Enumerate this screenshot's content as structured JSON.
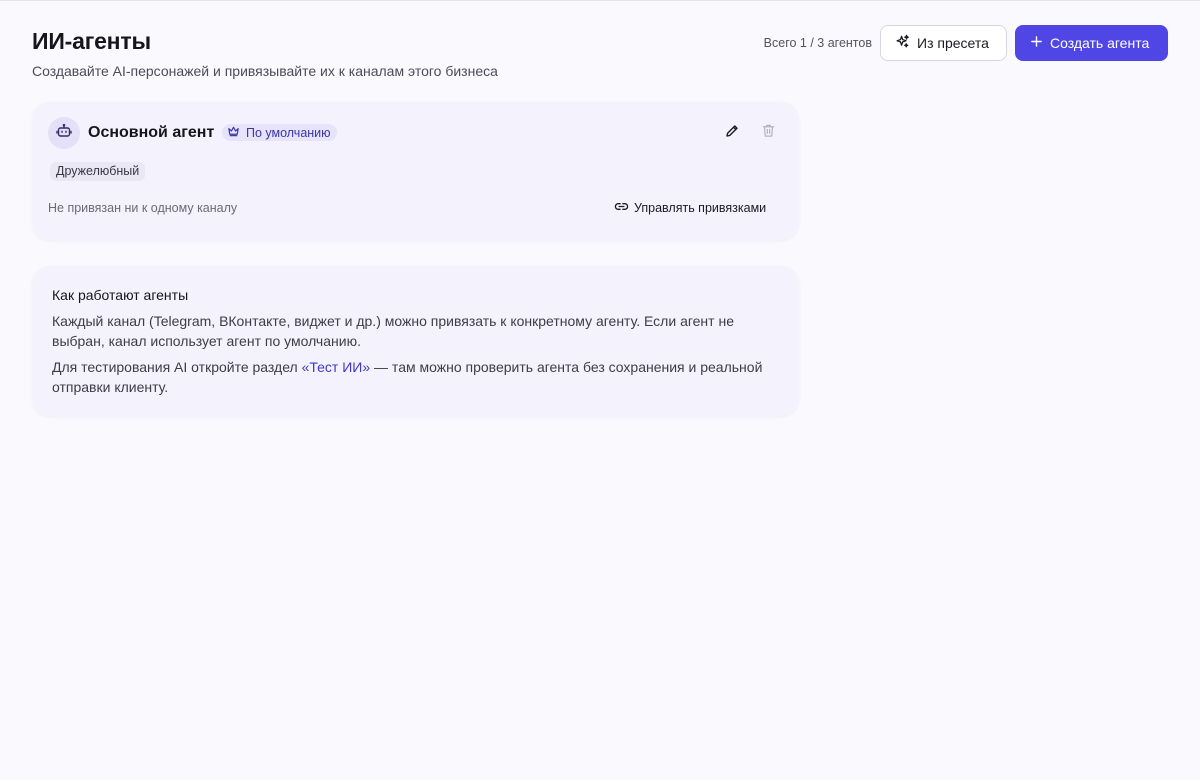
{
  "header": {
    "title": "ИИ-агенты",
    "subtitle": "Создавайте AI-персонажей и привязывайте их к каналам этого бизнеса",
    "agent_count": "Всего 1 / 3 агентов",
    "preset_button_label": "Из пресета",
    "create_button_label": "Создать агента",
    "accent_color": "#4f46e5"
  },
  "agents": [
    {
      "name": "Основной агент",
      "badge": "По умолчанию",
      "tone": "Дружелюбный",
      "channels_status": "Не привязан ни к одному каналу",
      "manage_label": "Управлять привязками",
      "icons": {
        "avatar": "bot-icon",
        "badge": "crown-icon",
        "edit": "pencil-icon",
        "delete": "trash-icon",
        "manage": "link-icon"
      }
    }
  ],
  "info": {
    "title": "Как работают агенты",
    "p1": "Каждый канал (Telegram, ВКонтакте, виджет и др.) можно привязать к конкретному агенту. Если агент не выбран, канал использует агент по умолчанию.",
    "p2_before": "Для тестирования AI откройте раздел ",
    "p2_link": "«Тест ИИ»",
    "p2_after": " — там можно проверить агента без сохранения и реальной отправки клиенту."
  }
}
